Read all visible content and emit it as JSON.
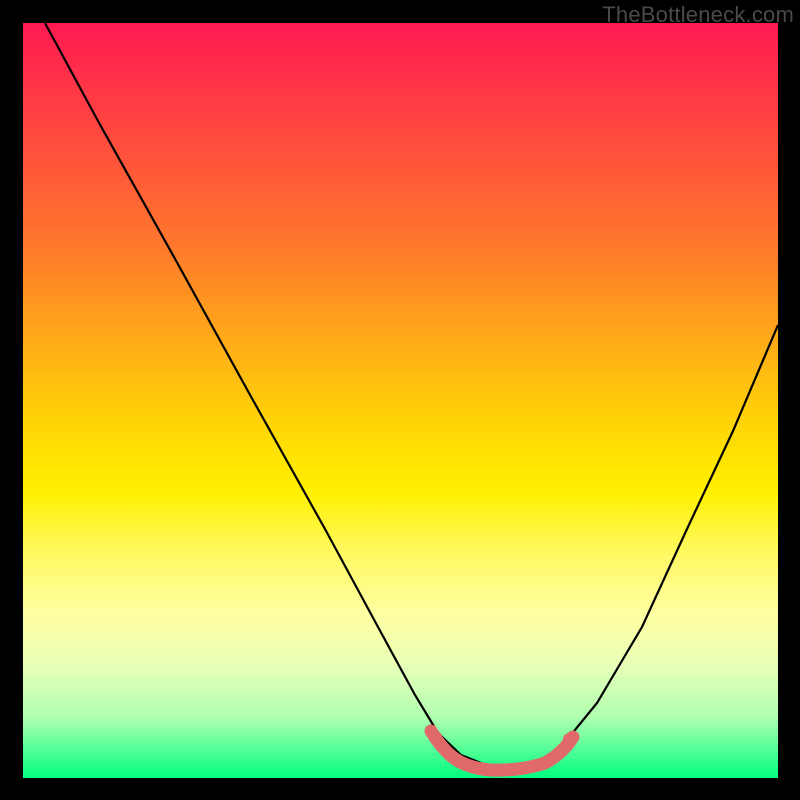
{
  "watermark": "TheBottleneck.com",
  "colors": {
    "background": "#000000",
    "gradient_top": "#ff1a52",
    "gradient_bottom": "#00ff7f",
    "curve": "#000000",
    "highlight": "#e06a6a"
  },
  "chart_data": {
    "type": "line",
    "title": "",
    "xlabel": "",
    "ylabel": "",
    "xlim": [
      0,
      100
    ],
    "ylim": [
      0,
      100
    ],
    "grid": false,
    "series": [
      {
        "name": "bottleneck-curve",
        "x": [
          3,
          10,
          20,
          30,
          40,
          47,
          52,
          55,
          58,
          62,
          66,
          70,
          72,
          76,
          82,
          88,
          94,
          100
        ],
        "y": [
          100,
          87,
          69,
          51,
          33,
          20,
          11,
          6,
          3,
          1.5,
          1.5,
          3,
          5,
          10,
          20,
          33,
          46,
          60
        ]
      }
    ],
    "highlight_region": {
      "name": "optimal-band",
      "x_start": 54,
      "x_end": 73,
      "y_approx": 2
    }
  }
}
